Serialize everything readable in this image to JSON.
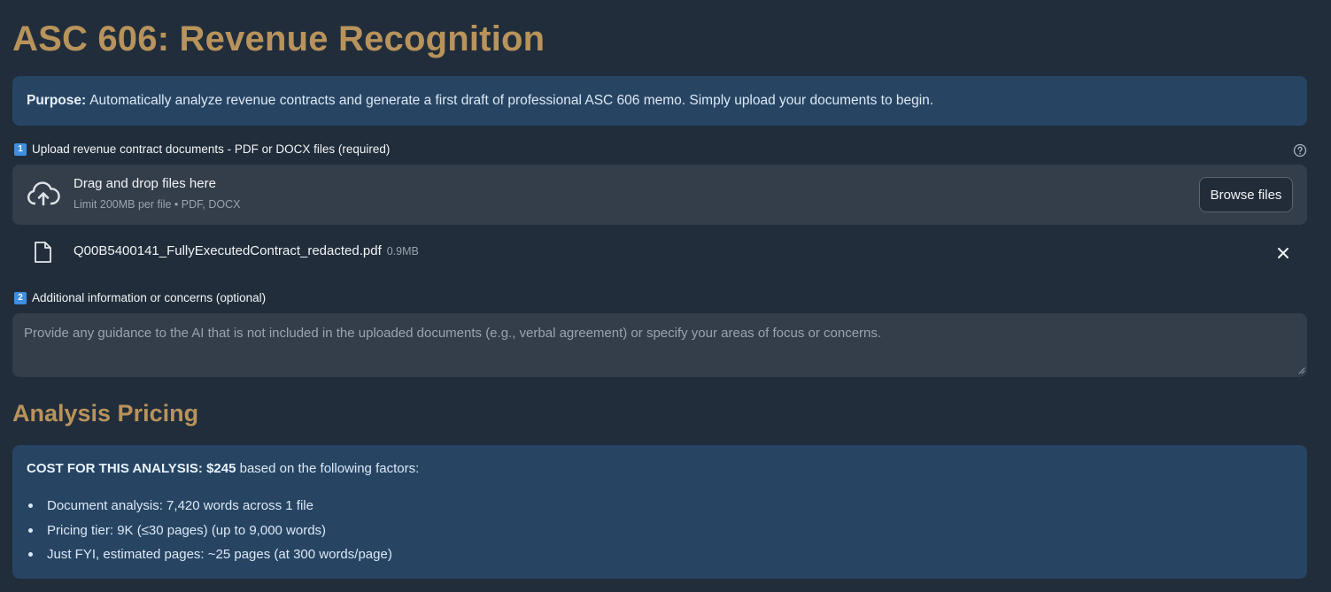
{
  "header": {
    "title": "ASC 606: Revenue Recognition"
  },
  "purpose": {
    "label": "Purpose:",
    "text": "Automatically analyze revenue contracts and generate a first draft of professional ASC 606 memo. Simply upload your documents to begin."
  },
  "upload": {
    "step": "1",
    "label": "Upload revenue contract documents - PDF or DOCX files (required)",
    "dropzone_title": "Drag and drop files here",
    "dropzone_sub": "Limit 200MB per file • PDF, DOCX",
    "browse_label": "Browse files",
    "file": {
      "name": "Q00B5400141_FullyExecutedContract_redacted.pdf",
      "size": "0.9MB"
    }
  },
  "additional": {
    "step": "2",
    "label": "Additional information or concerns (optional)",
    "placeholder": "Provide any guidance to the AI that is not included in the uploaded documents (e.g., verbal agreement) or specify your areas of focus or concerns."
  },
  "pricing": {
    "title": "Analysis Pricing",
    "cost_label": "COST FOR THIS ANALYSIS: $245",
    "cost_suffix": " based on the following factors:",
    "factors": [
      "Document analysis: 7,420 words across 1 file",
      "Pricing tier: 9K (≤30 pages) (up to 9,000 words)",
      "Just FYI, estimated pages: ~25 pages (at 300 words/page)"
    ]
  },
  "colors": {
    "accent": "#b8935b",
    "info_bg": "#274563",
    "page_bg": "#212d3b"
  },
  "icons": [
    "help-icon",
    "cloud-upload-icon",
    "file-icon",
    "close-icon"
  ]
}
